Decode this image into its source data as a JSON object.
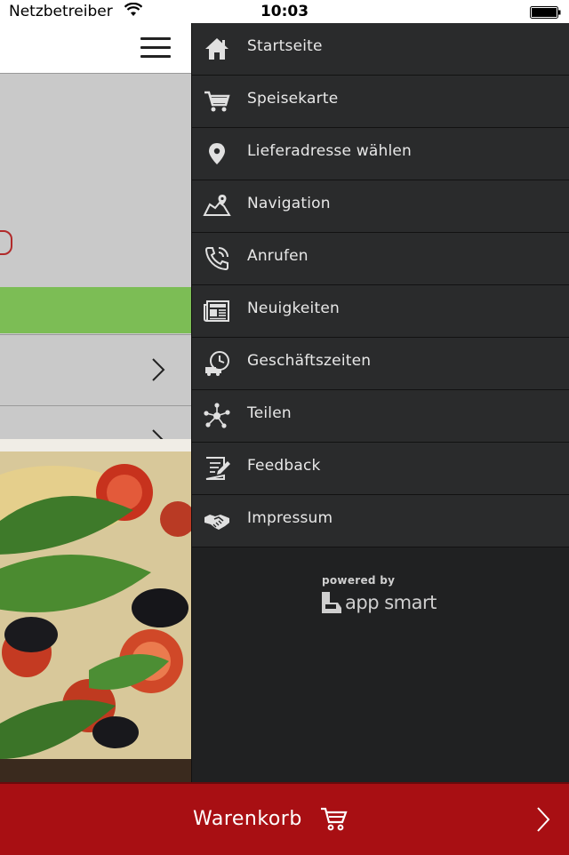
{
  "status_bar": {
    "carrier": "Netzbetreiber",
    "time": "10:03",
    "icons": [
      "wifi-icon",
      "battery-icon"
    ]
  },
  "menu": {
    "items": [
      {
        "label": "Startseite",
        "icon": "home-icon"
      },
      {
        "label": "Speisekarte",
        "icon": "cart-icon"
      },
      {
        "label": "Lieferadresse wählen",
        "icon": "location-pin-icon"
      },
      {
        "label": "Navigation",
        "icon": "map-icon"
      },
      {
        "label": "Anrufen",
        "icon": "phone-icon"
      },
      {
        "label": "Neuigkeiten",
        "icon": "newspaper-icon"
      },
      {
        "label": "Geschäftszeiten",
        "icon": "delivery-clock-icon"
      },
      {
        "label": "Teilen",
        "icon": "share-icon"
      },
      {
        "label": "Feedback",
        "icon": "feedback-icon"
      },
      {
        "label": "Impressum",
        "icon": "handshake-icon"
      }
    ],
    "powered_by": "powered by",
    "brand": "app smart"
  },
  "cart_bar": {
    "label": "Warenkorb",
    "icon": "cart-icon"
  },
  "colors": {
    "drawer_bg": "#2a2b2c",
    "cart_bar": "#a80f13",
    "accent_green": "#7cbd55",
    "menu_text": "#e8e8e8"
  }
}
